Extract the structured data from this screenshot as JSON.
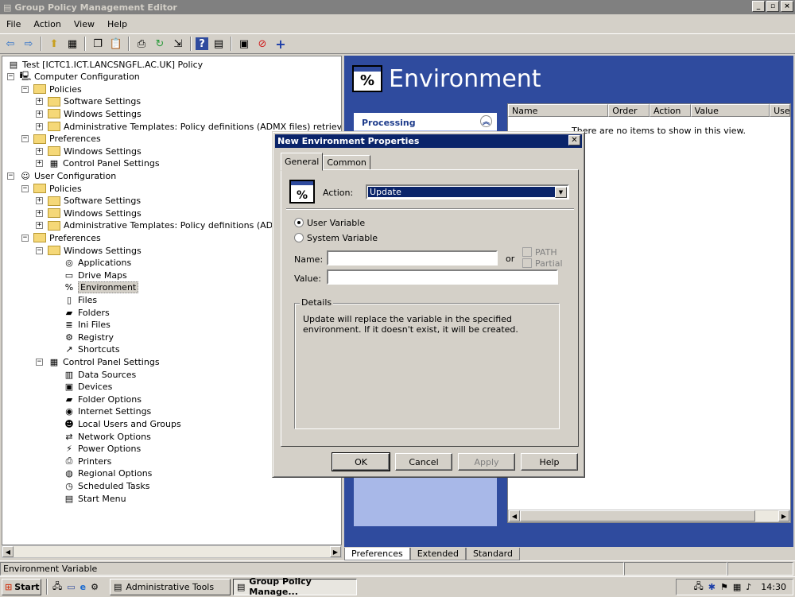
{
  "window": {
    "title": "Group Policy Management Editor",
    "min": "_",
    "max": "▫",
    "close": "×"
  },
  "menu": [
    "File",
    "Action",
    "View",
    "Help"
  ],
  "tree": [
    {
      "label": "Test [ICTC1.ICT.LANCSNGFL.AC.UK] Policy",
      "level": 0,
      "exp": "",
      "icon": "policy-icon"
    },
    {
      "label": "Computer Configuration",
      "level": 0,
      "exp": "−",
      "icon": "computer-icon"
    },
    {
      "label": "Policies",
      "level": 1,
      "exp": "−",
      "icon": "folder-icon"
    },
    {
      "label": "Software Settings",
      "level": 2,
      "exp": "+",
      "icon": "folder-icon"
    },
    {
      "label": "Windows Settings",
      "level": 2,
      "exp": "+",
      "icon": "folder-icon"
    },
    {
      "label": "Administrative Templates: Policy definitions (ADMX files) retrieved from the",
      "level": 2,
      "exp": "+",
      "icon": "folder-icon"
    },
    {
      "label": "Preferences",
      "level": 1,
      "exp": "−",
      "icon": "folder-icon"
    },
    {
      "label": "Windows Settings",
      "level": 2,
      "exp": "+",
      "icon": "folder-icon"
    },
    {
      "label": "Control Panel Settings",
      "level": 2,
      "exp": "+",
      "icon": "control-panel-icon"
    },
    {
      "label": "User Configuration",
      "level": 0,
      "exp": "−",
      "icon": "user-icon"
    },
    {
      "label": "Policies",
      "level": 1,
      "exp": "−",
      "icon": "folder-icon"
    },
    {
      "label": "Software Settings",
      "level": 2,
      "exp": "+",
      "icon": "folder-icon"
    },
    {
      "label": "Windows Settings",
      "level": 2,
      "exp": "+",
      "icon": "folder-icon"
    },
    {
      "label": "Administrative Templates: Policy definitions (ADMX files)",
      "level": 2,
      "exp": "+",
      "icon": "folder-icon"
    },
    {
      "label": "Preferences",
      "level": 1,
      "exp": "−",
      "icon": "folder-icon"
    },
    {
      "label": "Windows Settings",
      "level": 2,
      "exp": "−",
      "icon": "folder-icon"
    },
    {
      "label": "Applications",
      "level": 3,
      "exp": "",
      "icon": "applications-icon"
    },
    {
      "label": "Drive Maps",
      "level": 3,
      "exp": "",
      "icon": "drive-maps-icon"
    },
    {
      "label": "Environment",
      "level": 3,
      "exp": "",
      "icon": "environment-icon",
      "selected": true
    },
    {
      "label": "Files",
      "level": 3,
      "exp": "",
      "icon": "files-icon"
    },
    {
      "label": "Folders",
      "level": 3,
      "exp": "",
      "icon": "folders-icon"
    },
    {
      "label": "Ini Files",
      "level": 3,
      "exp": "",
      "icon": "ini-files-icon"
    },
    {
      "label": "Registry",
      "level": 3,
      "exp": "",
      "icon": "registry-icon"
    },
    {
      "label": "Shortcuts",
      "level": 3,
      "exp": "",
      "icon": "shortcuts-icon"
    },
    {
      "label": "Control Panel Settings",
      "level": 2,
      "exp": "−",
      "icon": "control-panel-icon"
    },
    {
      "label": "Data Sources",
      "level": 3,
      "exp": "",
      "icon": "data-sources-icon"
    },
    {
      "label": "Devices",
      "level": 3,
      "exp": "",
      "icon": "devices-icon"
    },
    {
      "label": "Folder Options",
      "level": 3,
      "exp": "",
      "icon": "folder-options-icon"
    },
    {
      "label": "Internet Settings",
      "level": 3,
      "exp": "",
      "icon": "internet-settings-icon"
    },
    {
      "label": "Local Users and Groups",
      "level": 3,
      "exp": "",
      "icon": "local-users-icon"
    },
    {
      "label": "Network Options",
      "level": 3,
      "exp": "",
      "icon": "network-options-icon"
    },
    {
      "label": "Power Options",
      "level": 3,
      "exp": "",
      "icon": "power-options-icon"
    },
    {
      "label": "Printers",
      "level": 3,
      "exp": "",
      "icon": "printers-icon"
    },
    {
      "label": "Regional Options",
      "level": 3,
      "exp": "",
      "icon": "regional-options-icon"
    },
    {
      "label": "Scheduled Tasks",
      "level": 3,
      "exp": "",
      "icon": "scheduled-tasks-icon"
    },
    {
      "label": "Start Menu",
      "level": 3,
      "exp": "",
      "icon": "start-menu-icon"
    }
  ],
  "right": {
    "title": "Environment",
    "icon_glyph": "%",
    "processing": "Processing",
    "columns": [
      "Name",
      "Order",
      "Action",
      "Value",
      "Use"
    ],
    "empty": "There are no items to show in this view.",
    "tabs": [
      "Preferences",
      "Extended",
      "Standard"
    ]
  },
  "status": {
    "text": "Environment Variable"
  },
  "taskbar": {
    "start": "Start",
    "items": [
      "Administrative Tools",
      "Group Policy Manage..."
    ],
    "clock": "14:30"
  },
  "dialog": {
    "title": "New Environment Properties",
    "tabs": [
      "General",
      "Common"
    ],
    "action_label": "Action:",
    "action_value": "Update",
    "radio_user": "User Variable",
    "radio_system": "System Variable",
    "name_label": "Name:",
    "name_value": "",
    "or_label": "or",
    "path_label": "PATH",
    "partial_label": "Partial",
    "value_label": "Value:",
    "value_value": "",
    "details_label": "Details",
    "details_text": "Update will replace the variable in the specified environment. If it doesn't exist, it will be created.",
    "buttons": {
      "ok": "OK",
      "cancel": "Cancel",
      "apply": "Apply",
      "help": "Help"
    }
  },
  "colors": {
    "selection": "#0a246a",
    "header_blue": "#2f4b9e",
    "panel_blue": "#a8b8e8"
  }
}
